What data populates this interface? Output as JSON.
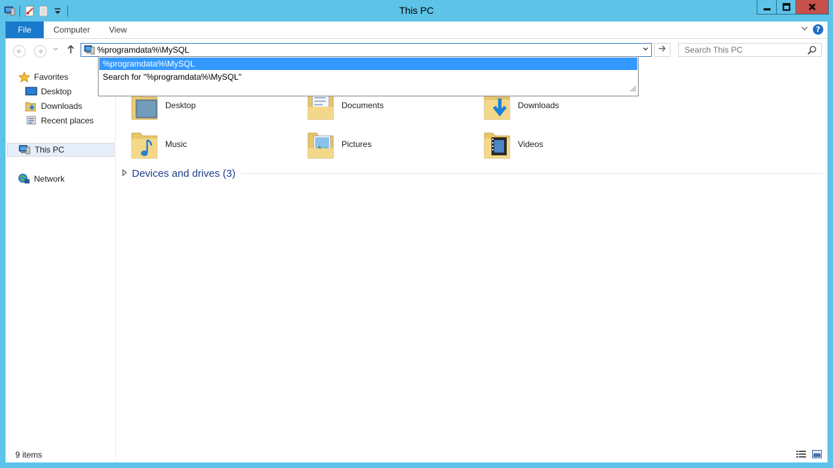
{
  "window": {
    "title": "This PC"
  },
  "ribbon": {
    "tabs": [
      "File",
      "Computer",
      "View"
    ]
  },
  "address": {
    "value": "%programdata%\\MySQL"
  },
  "autocomplete": {
    "items": [
      "%programdata%\\MySQL",
      "Search for \"%programdata%\\MySQL\""
    ]
  },
  "search": {
    "placeholder": "Search This PC"
  },
  "sidebar": {
    "favorites": "Favorites",
    "items": [
      "Desktop",
      "Downloads",
      "Recent places"
    ],
    "this_pc": "This PC",
    "network": "Network"
  },
  "folders": [
    "Desktop",
    "Documents",
    "Downloads",
    "Music",
    "Pictures",
    "Videos"
  ],
  "group": {
    "label": "Devices and drives (3)"
  },
  "status": {
    "items": "9 items"
  },
  "colors": {
    "titlebar": "#5ec3e8",
    "file_tab": "#1979ca",
    "selection": "#3399ff",
    "group_header": "#1e3f8c"
  }
}
